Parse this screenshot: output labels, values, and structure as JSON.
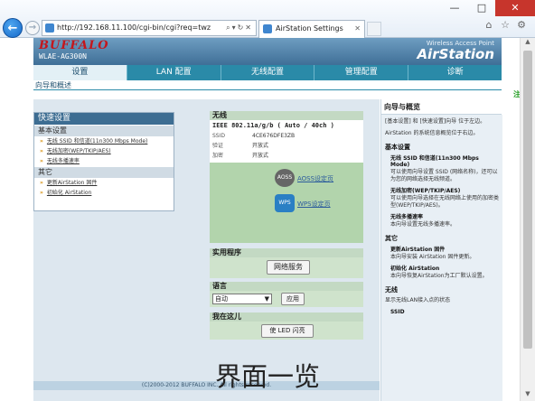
{
  "browser": {
    "url": "http://192.168.11.100/cgi-bin/cgi?req=twz",
    "tab_title": "AirStation Settings",
    "window_controls": {
      "minimize": "—",
      "maximize": "□",
      "close": "✕"
    }
  },
  "banner": {
    "logo": "BUFFALO",
    "model": "WLAE-AG300N",
    "subtitle": "Wireless Access Point",
    "brand": "AirStation"
  },
  "tabs": [
    {
      "label": "设置",
      "active": true
    },
    {
      "label": "LAN 配置",
      "active": false
    },
    {
      "label": "无线配置",
      "active": false
    },
    {
      "label": "管理配置",
      "active": false
    },
    {
      "label": "诊断",
      "active": false
    }
  ],
  "subnav": {
    "link": "向导和概述"
  },
  "help_label": "注销",
  "quick": {
    "title": "快速设置",
    "basic_section": "基本设置",
    "basic_items": [
      "无线 SSID 和信道(11n300 Mbps Mode)",
      "无线加密(WEP/TKIP/AES)",
      "无线多播速率"
    ],
    "other_section": "其它",
    "other_items": [
      "更新AirStation 固件",
      "初始化 AirStation"
    ]
  },
  "wireless": {
    "title": "无线",
    "mode": "IEEE 802.11a/g/b ( Auto / 40ch )",
    "rows": [
      {
        "key": "SSID",
        "value": "4CE676DFE3ZB"
      },
      {
        "key": "验证",
        "value": "开放式"
      },
      {
        "key": "加密",
        "value": "开放式"
      }
    ],
    "aoss_label": "AOSS设定页",
    "wps_label": "WPS设定页",
    "aoss_icon_text": "AOSS",
    "wps_icon_text": "WPS"
  },
  "utilities": {
    "title": "实用程序",
    "button": "网络服务"
  },
  "language": {
    "title": "语言",
    "selected": "自动",
    "apply_button": "应用"
  },
  "locate": {
    "title": "我在这儿",
    "button": "使 LED 闪亮"
  },
  "side": {
    "title": "向导与概览",
    "intro": "[基本设置] 和 [快速设置]向导 位于左边。",
    "intro2": "AirStation 的系统信息概览位于右边。",
    "basic_header": "基本设置",
    "entries": [
      {
        "title": "无线 SSID 和信道(11n300 Mbps Mode)",
        "desc": "可以使用向导设置 SSID (网络名称)，还可以为您的网络选择无线频道。"
      },
      {
        "title": "无线加密(WEP/TKIP/AES)",
        "desc": "可以使用向导选择在无线网络上使用的加密类型(WEP/TKIP/AES)。"
      },
      {
        "title": "无线多播速率",
        "desc": "本向导设置无线多播速率。"
      }
    ],
    "other_header": "其它",
    "other_entries": [
      {
        "title": "更新AirStation 固件",
        "desc": "本向导安装 AirStation 固件更新。"
      },
      {
        "title": "初始化 AirStation",
        "desc": "本向导恢复AirStation为工厂默认设置。"
      }
    ],
    "wireless_header": "无线",
    "wireless_desc": "显示无线LAN接入点的状态",
    "ssid_label": "SSID"
  },
  "overlay_text": "界面一览",
  "copyright": "(C)2000-2012 BUFFALO INC. All rights reserved."
}
